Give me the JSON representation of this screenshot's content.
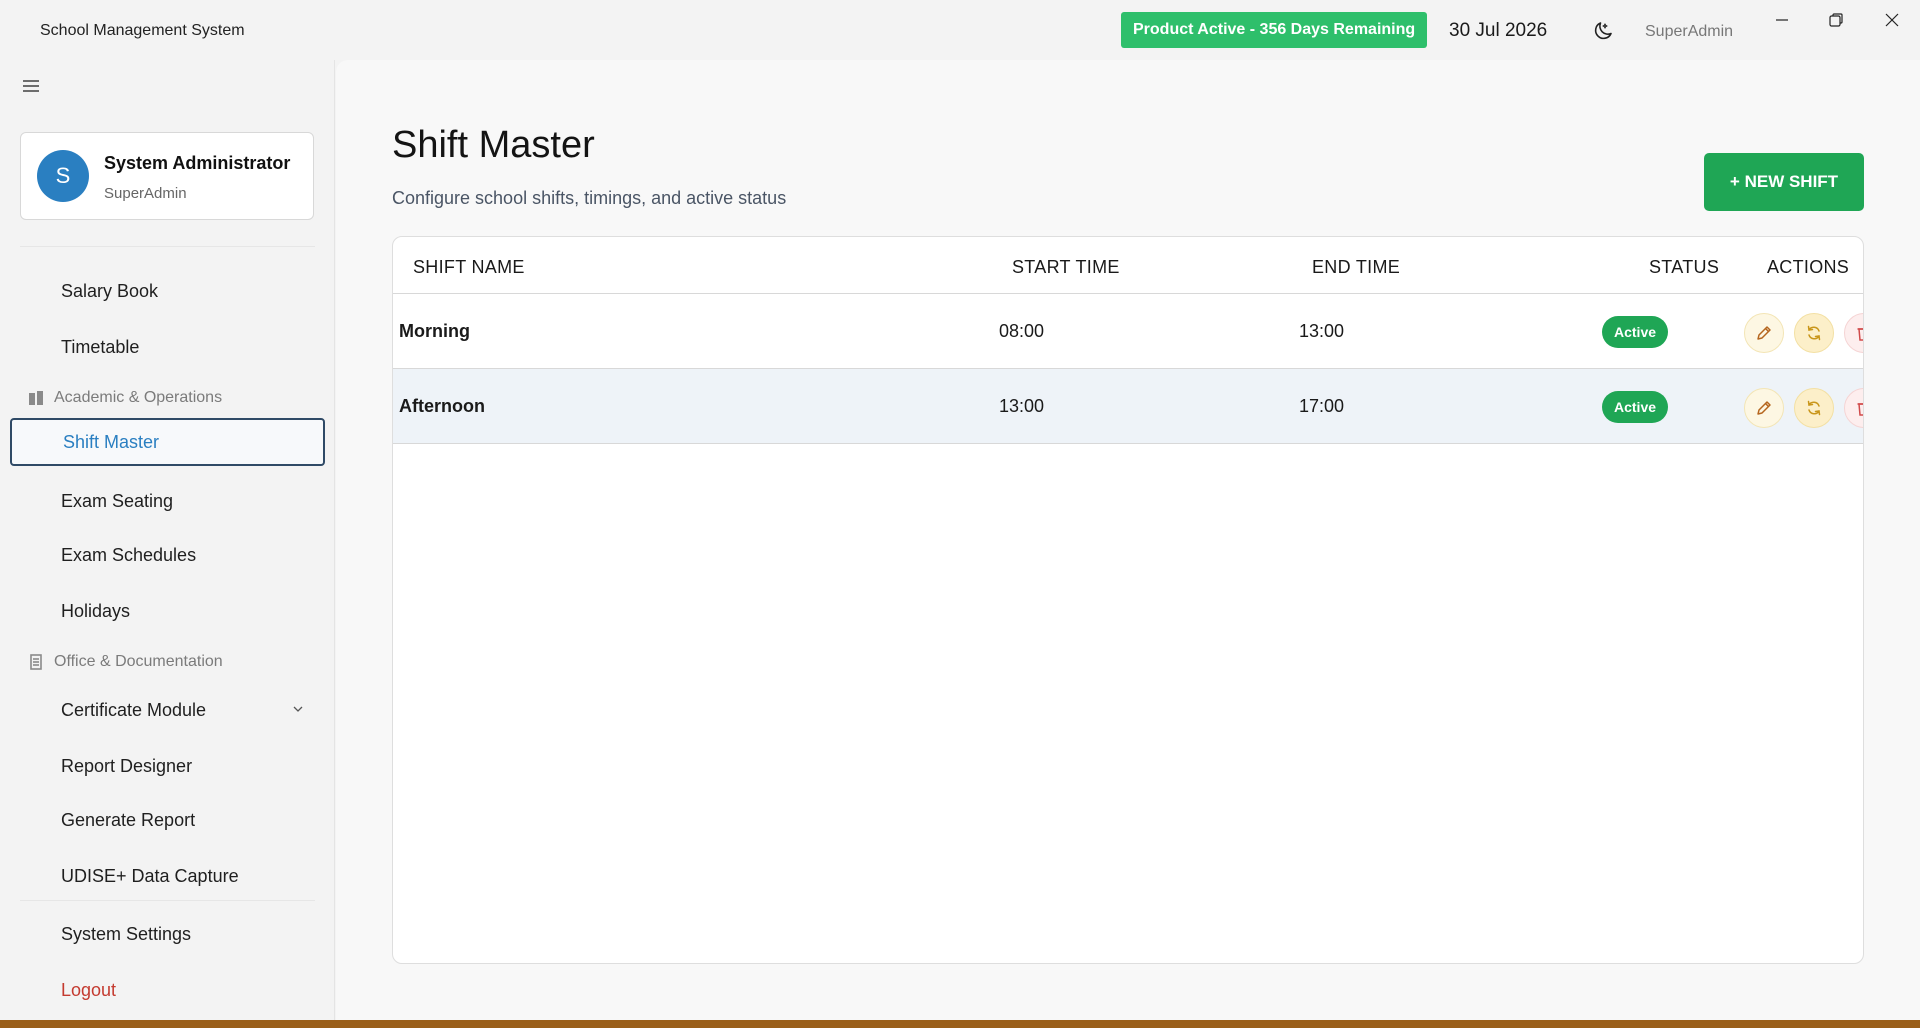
{
  "app": {
    "title": "School Management System",
    "license": "Product Active - 356 Days Remaining",
    "date": "30 Jul 2026",
    "user": "SuperAdmin"
  },
  "colors": {
    "accent": "#2a7fc1",
    "success": "#1fa655",
    "license_green": "#2ebf6b",
    "logout_red": "#c43a2f"
  },
  "profile": {
    "initial": "S",
    "name": "System Administrator",
    "role": "SuperAdmin"
  },
  "sidebar": {
    "items_top": [
      {
        "label": "Salary Book"
      },
      {
        "label": "Timetable"
      }
    ],
    "section_academic": "Academic & Operations",
    "items_academic": [
      {
        "label": "Shift Master",
        "active": true
      },
      {
        "label": "Exam Seating"
      },
      {
        "label": "Exam Schedules"
      },
      {
        "label": "Holidays"
      }
    ],
    "section_office": "Office & Documentation",
    "items_office": [
      {
        "label": "Certificate Module"
      },
      {
        "label": "Report Designer"
      },
      {
        "label": "Generate Report"
      },
      {
        "label": "UDISE+ Data Capture"
      }
    ],
    "settings": "System Settings",
    "logout": "Logout"
  },
  "main": {
    "title": "Shift Master",
    "subtitle": "Configure school shifts, timings, and active status",
    "new_button": "+ NEW SHIFT",
    "columns": [
      "SHIFT NAME",
      "START TIME",
      "END TIME",
      "STATUS",
      "ACTIONS"
    ],
    "rows": [
      {
        "name": "Morning",
        "start": "08:00",
        "end": "13:00",
        "status": "Active"
      },
      {
        "name": "Afternoon",
        "start": "13:00",
        "end": "17:00",
        "status": "Active"
      }
    ]
  },
  "icons": {
    "menu": "hamburger-icon",
    "theme": "moon-icon",
    "edit": "pencil-icon",
    "toggle": "refresh-icon",
    "delete": "trash-icon"
  }
}
